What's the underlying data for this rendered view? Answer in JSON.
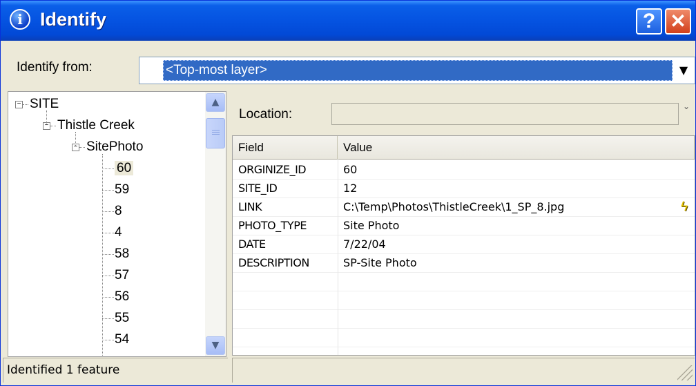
{
  "window": {
    "title": "Identify",
    "icon": "info-icon",
    "info_glyph": "i",
    "help_glyph": "?",
    "close_glyph": "✕",
    "title_bar_color": "#0553e1"
  },
  "identify_from": {
    "label": "Identify from:",
    "selected": "<Top-most layer>",
    "arrow_glyph": "▼"
  },
  "tree": {
    "nodes": [
      {
        "label": "SITE",
        "expanded": true,
        "level": 0
      },
      {
        "label": "Thistle Creek",
        "expanded": true,
        "level": 1
      },
      {
        "label": "SitePhoto",
        "expanded": true,
        "level": 2
      },
      {
        "label": "60",
        "level": 3,
        "selected": true
      },
      {
        "label": "59",
        "level": 3
      },
      {
        "label": "8",
        "level": 3
      },
      {
        "label": "4",
        "level": 3
      },
      {
        "label": "58",
        "level": 3
      },
      {
        "label": "57",
        "level": 3
      },
      {
        "label": "56",
        "level": 3
      },
      {
        "label": "55",
        "level": 3
      },
      {
        "label": "54",
        "level": 3
      }
    ],
    "scroll_up_glyph": "▲",
    "scroll_down_glyph": "▼"
  },
  "location": {
    "label": "Location:",
    "value": "",
    "dropdown_glyph": "⌄"
  },
  "table": {
    "headers": [
      "Field",
      "Value"
    ],
    "rows": [
      {
        "field": "ORGINIZE_ID",
        "value": "60"
      },
      {
        "field": "SITE_ID",
        "value": "12"
      },
      {
        "field": "LINK",
        "value": "C:\\Temp\\Photos\\ThistleCreek\\1_SP_8.jpg",
        "hyperlink": true
      },
      {
        "field": "PHOTO_TYPE",
        "value": "Site Photo"
      },
      {
        "field": "DATE",
        "value": "7/22/04"
      },
      {
        "field": "DESCRIPTION",
        "value": "SP-Site Photo"
      }
    ],
    "hyperlink_icon": "lightning-bolt-icon",
    "hyperlink_glyph": "ϟ"
  },
  "status": {
    "text": "Identified 1 feature"
  },
  "colors": {
    "selection": "#316ac5",
    "panel": "#ece9d8"
  }
}
